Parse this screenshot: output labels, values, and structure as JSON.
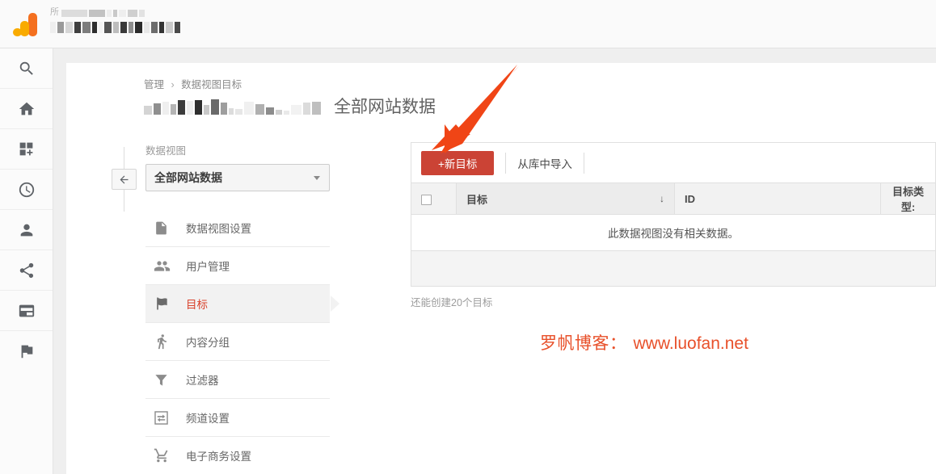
{
  "header": {
    "logo_icon": "google-analytics-logo",
    "account_line_redacted": true,
    "faint_glyph": "所"
  },
  "rail": {
    "items": [
      {
        "icon": "search-icon",
        "name": "search"
      },
      {
        "icon": "home-icon",
        "name": "home"
      },
      {
        "icon": "customization-icon",
        "name": "customization"
      },
      {
        "icon": "clock-icon",
        "name": "realtime"
      },
      {
        "icon": "person-icon",
        "name": "audience"
      },
      {
        "icon": "share-icon",
        "name": "acquisition"
      },
      {
        "icon": "card-icon",
        "name": "behavior"
      },
      {
        "icon": "flag-icon",
        "name": "conversions"
      }
    ]
  },
  "breadcrumb": {
    "parent": "管理",
    "separator": "›",
    "current": "数据视图目标"
  },
  "page": {
    "view_title": "全部网站数据",
    "property_name_redacted": true
  },
  "collapse": {
    "icon": "arrow-left-icon"
  },
  "nav": {
    "section_label": "数据视图",
    "view_selector": {
      "value": "全部网站数据",
      "caret_icon": "chevron-down-icon"
    },
    "items": [
      {
        "label": "数据视图设置",
        "icon": "document-icon",
        "active": false
      },
      {
        "label": "用户管理",
        "icon": "people-icon",
        "active": false
      },
      {
        "label": "目标",
        "icon": "flag-icon",
        "active": true
      },
      {
        "label": "内容分组",
        "icon": "walking-icon",
        "active": false
      },
      {
        "label": "过滤器",
        "icon": "funnel-icon",
        "active": false
      },
      {
        "label": "频道设置",
        "icon": "channels-icon",
        "active": false
      },
      {
        "label": "电子商务设置",
        "icon": "cart-icon",
        "active": false
      }
    ]
  },
  "toolbar": {
    "new_goal_label": "+新目标",
    "import_label": "从库中导入"
  },
  "table": {
    "headers": {
      "checkbox": "",
      "goal": "目标",
      "sort_icon": "↓",
      "id": "ID",
      "goal_type": "目标类型:"
    },
    "empty_message": "此数据视图没有相关数据。",
    "rows": []
  },
  "quota_text": "还能创建20个目标",
  "annotations": {
    "arrow": {
      "color": "#f04516",
      "points_to": "new-goal-button"
    },
    "watermark_cn": "罗帆博客：",
    "watermark_url": "www.luofan.net"
  },
  "colors": {
    "accent_red": "#cb4335",
    "active_text": "#d9402a",
    "annotation": "#f04516",
    "watermark": "#e8502a"
  }
}
